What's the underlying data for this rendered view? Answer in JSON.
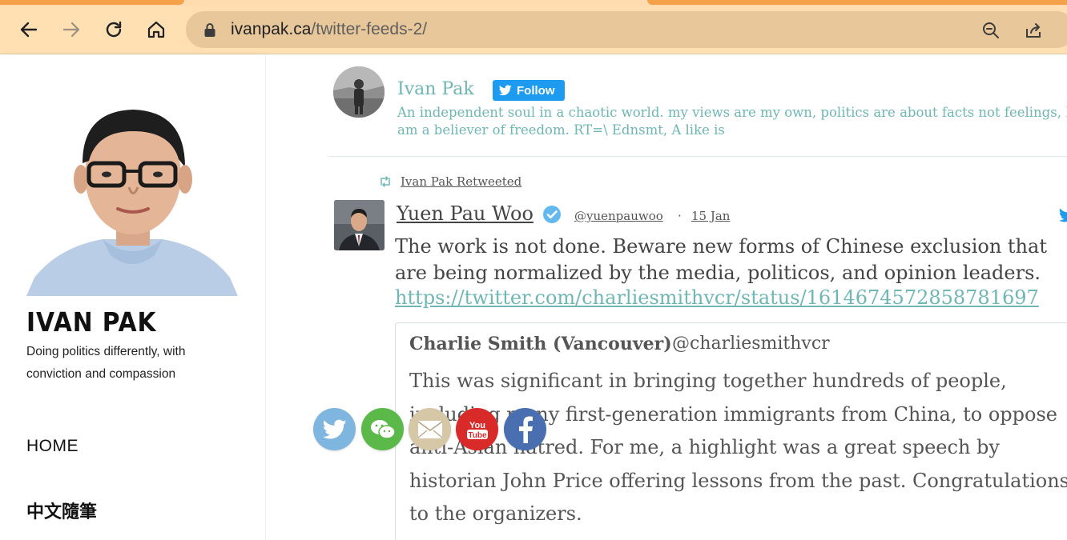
{
  "browser": {
    "url_domain": "ivanpak.ca",
    "url_path": "/twitter-feeds-2/",
    "icons": [
      "back-icon",
      "forward-icon",
      "reload-icon",
      "home-icon",
      "lock-icon",
      "zoom-icon",
      "share-icon"
    ]
  },
  "sidebar": {
    "site_title": "IVAN PAK",
    "tagline": "Doing politics differently, with conviction and compassion",
    "nav": [
      {
        "label": "HOME"
      },
      {
        "label": "中文隨筆"
      }
    ]
  },
  "profile": {
    "name": "Ivan Pak",
    "follow_label": "Follow",
    "bio": "An independent soul in a chaotic world. my views are my own, politics are about facts not feelings, I am a believer of freedom. RT=\\ Ednsmt, A like is"
  },
  "tweet": {
    "retweet_label": "Ivan Pak Retweeted",
    "author": "Yuen Pau Woo",
    "handle": "@yuenpauwoo",
    "separator": "·",
    "date": "15 Jan",
    "text": "The work is not done. Beware new forms of Chinese exclusion that are being normalized by the media, politicos, and opinion leaders.",
    "link": "https://twitter.com/charliesmithvcr/status/1614674572858781697",
    "quote": {
      "author": "Charlie Smith (Vancouver)",
      "handle": "@charliesmithvcr",
      "text": "This was significant in bringing together hundreds of people, including many first-generation immigrants from China, to oppose anti-Asian hatred. For me, a highlight was a great speech by historian John Price offering lessons from the past. Congratulations to the organizers."
    }
  },
  "share_bar": [
    "twitter",
    "wechat",
    "email",
    "youtube",
    "facebook"
  ],
  "youtube_logo": {
    "line1": "You",
    "line2": "Tube"
  },
  "colors": {
    "accent_teal": "#6eb7b5",
    "twitter_blue": "#1d9bf0",
    "toolbar": "#ffe0b2",
    "tab_orange": "#f4a14a"
  }
}
